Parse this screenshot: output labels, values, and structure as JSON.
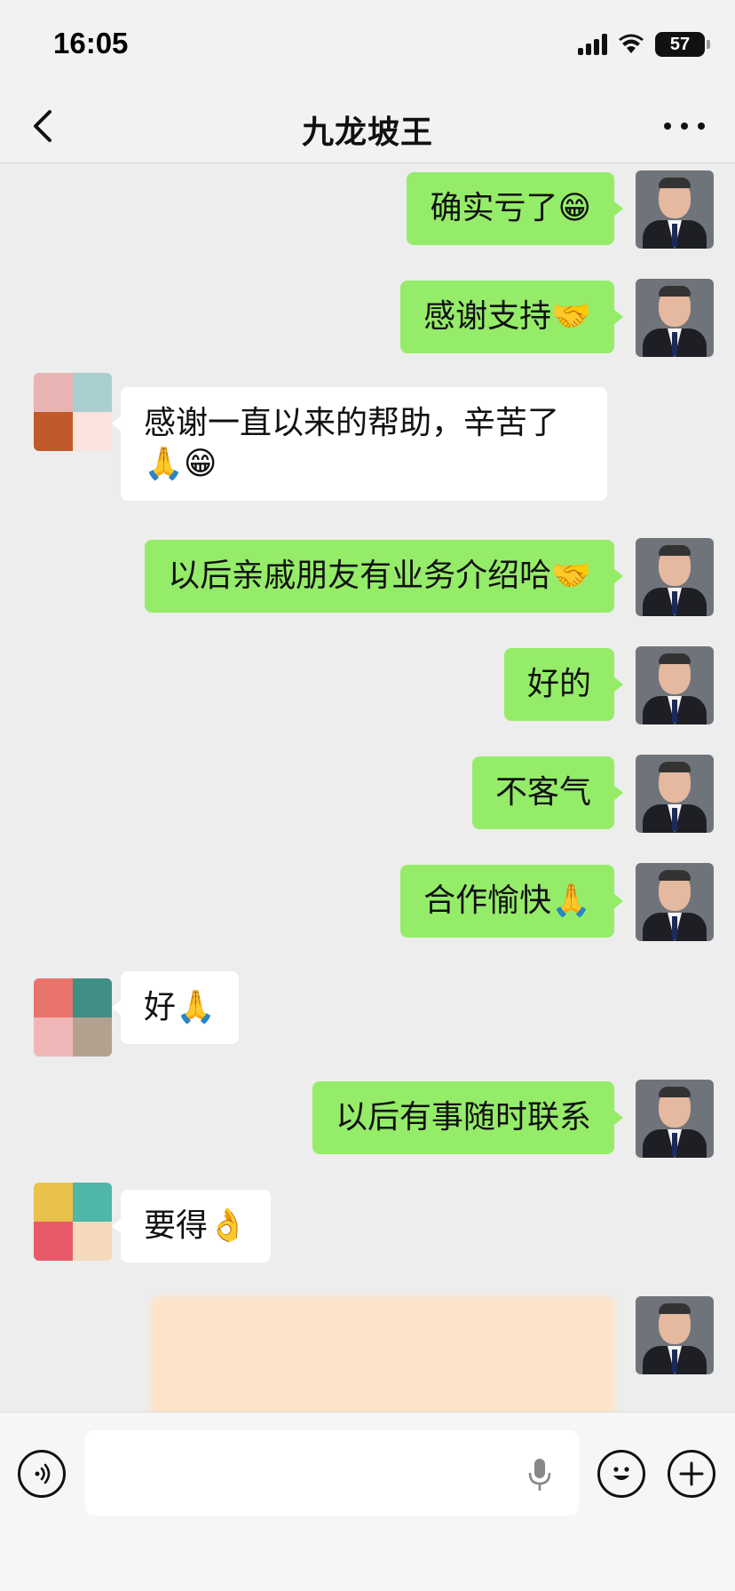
{
  "status_bar": {
    "time": "16:05",
    "battery": "57"
  },
  "header": {
    "title": "九龙坡王"
  },
  "messages": [
    {
      "side": "me",
      "text": "确实亏了😁"
    },
    {
      "side": "me",
      "text": "感谢支持🤝"
    },
    {
      "side": "other",
      "text": "感谢一直以来的帮助，辛苦了🙏😁"
    },
    {
      "side": "me",
      "text": "以后亲戚朋友有业务介绍哈🤝"
    },
    {
      "side": "me",
      "text": "好的"
    },
    {
      "side": "me",
      "text": "不客气"
    },
    {
      "side": "me",
      "text": "合作愉快🙏"
    },
    {
      "side": "other",
      "text": "好🙏"
    },
    {
      "side": "me",
      "text": "以后有事随时联系"
    },
    {
      "side": "other",
      "text": "要得👌"
    }
  ],
  "input": {
    "placeholder": ""
  },
  "colors": {
    "my_bubble": "#95ec69",
    "other_bubble": "#ffffff",
    "background": "#ededed"
  }
}
